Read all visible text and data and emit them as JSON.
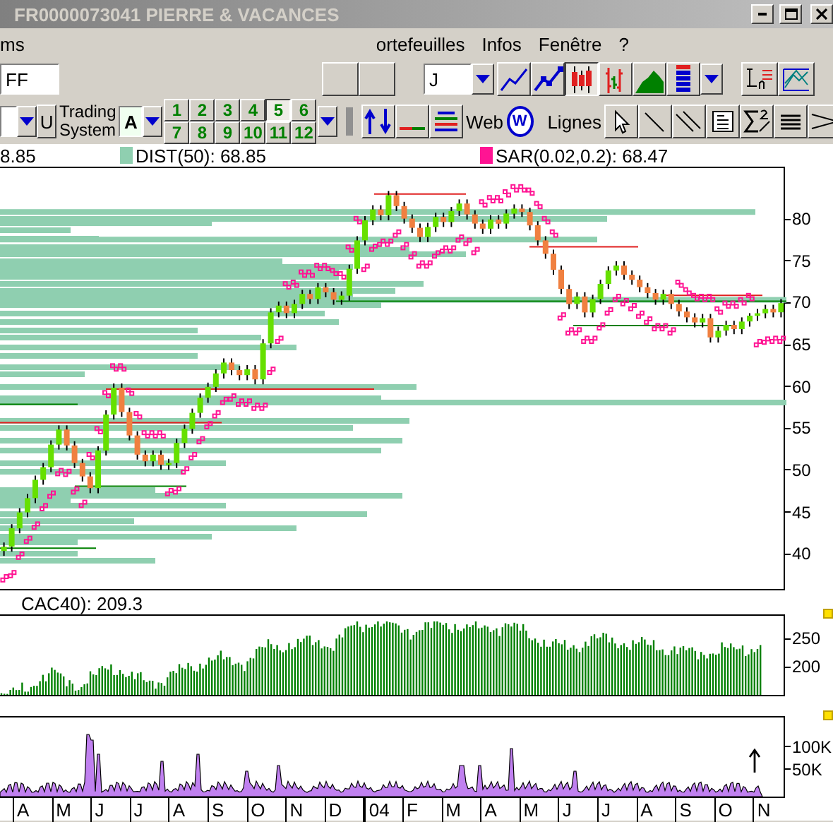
{
  "window": {
    "title": "FR0000073041  PIERRE & VACANCES",
    "active": false
  },
  "menu": [
    {
      "label": "ms"
    },
    {
      "label": "ortefeuilles"
    },
    {
      "label": "Infos"
    },
    {
      "label": "Fenêtre"
    },
    {
      "label": "?"
    }
  ],
  "toolbar_top": {
    "symbol_field": "FF",
    "period_field": "J",
    "chart_types": [
      {
        "kind": "line",
        "selected": false
      },
      {
        "kind": "line-points",
        "selected": false
      },
      {
        "kind": "candles",
        "selected": true
      },
      {
        "kind": "bars",
        "selected": false
      },
      {
        "kind": "area",
        "selected": false
      },
      {
        "kind": "colors",
        "selected": false
      }
    ]
  },
  "toolbar_bottom": {
    "u_button": "U",
    "trading_system_label": "Trading System",
    "system_field": "A",
    "layouts": [
      {
        "label": "1",
        "selected": false
      },
      {
        "label": "2",
        "selected": false
      },
      {
        "label": "3",
        "selected": false
      },
      {
        "label": "4",
        "selected": false
      },
      {
        "label": "5",
        "selected": true
      },
      {
        "label": "6",
        "selected": false
      },
      {
        "label": "7",
        "selected": false
      },
      {
        "label": "8",
        "selected": false
      },
      {
        "label": "9",
        "selected": false
      },
      {
        "label": "10",
        "selected": false
      },
      {
        "label": "11",
        "selected": false
      },
      {
        "label": "12",
        "selected": false
      }
    ],
    "web_label": "Web",
    "web_button": "W",
    "lines_label": "Lignes"
  },
  "price_panel": {
    "legends": [
      {
        "text": "8.85"
      },
      {
        "text": "DIST(50): 68.85",
        "color": "#8fcfb0"
      },
      {
        "text": "SAR(0.02,0.2): 68.47",
        "color": "#ff1493"
      }
    ],
    "chart_data": {
      "type": "candlestick",
      "ylim": [
        35.95,
        86.24
      ],
      "yticks": [
        80,
        75,
        70,
        65,
        60,
        55,
        50,
        45,
        40
      ],
      "ohlc": [
        [
          40.5,
          41.5,
          39.9,
          41.0
        ],
        [
          41.0,
          43.7,
          40.4,
          43.2
        ],
        [
          43.2,
          45.6,
          42.6,
          45.1
        ],
        [
          45.1,
          47.3,
          44.5,
          46.8
        ],
        [
          46.8,
          49.5,
          46.2,
          49.0
        ],
        [
          49.0,
          51.0,
          48.4,
          50.5
        ],
        [
          50.5,
          53.7,
          49.9,
          53.2
        ],
        [
          53.2,
          55.5,
          52.6,
          55.0
        ],
        [
          55.0,
          55.5,
          52.5,
          53.1
        ],
        [
          53.1,
          53.6,
          50.4,
          51.0
        ],
        [
          51.0,
          51.5,
          48.8,
          49.4
        ],
        [
          49.4,
          49.9,
          47.4,
          48.0
        ],
        [
          48.0,
          53.0,
          47.4,
          52.5
        ],
        [
          52.5,
          57.3,
          51.9,
          56.8
        ],
        [
          56.8,
          60.5,
          56.2,
          60.0
        ],
        [
          60.0,
          60.5,
          56.5,
          57.1
        ],
        [
          57.1,
          57.6,
          53.7,
          54.3
        ],
        [
          54.3,
          54.8,
          51.4,
          52.0
        ],
        [
          52.0,
          52.5,
          50.6,
          51.2
        ],
        [
          51.2,
          52.5,
          50.6,
          52.0
        ],
        [
          52.0,
          52.5,
          50.2,
          50.8
        ],
        [
          50.8,
          51.5,
          50.2,
          51.0
        ],
        [
          51.0,
          53.9,
          50.4,
          53.4
        ],
        [
          53.4,
          55.6,
          52.8,
          55.1
        ],
        [
          55.1,
          57.5,
          54.5,
          57.0
        ],
        [
          57.0,
          59.3,
          56.4,
          58.8
        ],
        [
          58.8,
          60.6,
          58.2,
          60.1
        ],
        [
          60.1,
          62.2,
          59.5,
          61.7
        ],
        [
          61.7,
          63.5,
          61.1,
          63.0
        ],
        [
          63.0,
          63.5,
          61.5,
          62.1
        ],
        [
          62.1,
          62.6,
          60.9,
          61.5
        ],
        [
          61.5,
          62.7,
          60.9,
          62.2
        ],
        [
          62.2,
          62.7,
          60.4,
          61.0
        ],
        [
          61.0,
          65.8,
          60.4,
          65.3
        ],
        [
          65.3,
          69.5,
          64.7,
          69.0
        ],
        [
          69.0,
          70.3,
          68.4,
          69.8
        ],
        [
          69.8,
          70.3,
          68.3,
          68.9
        ],
        [
          68.9,
          70.5,
          68.3,
          70.0
        ],
        [
          70.0,
          71.7,
          69.4,
          71.2
        ],
        [
          71.2,
          71.7,
          70.0,
          70.6
        ],
        [
          70.6,
          72.5,
          70.0,
          72.0
        ],
        [
          72.0,
          72.5,
          70.8,
          71.4
        ],
        [
          71.4,
          71.9,
          69.9,
          70.5
        ],
        [
          70.5,
          71.5,
          69.9,
          71.0
        ],
        [
          71.0,
          74.7,
          70.4,
          74.2
        ],
        [
          74.2,
          78.1,
          73.6,
          77.6
        ],
        [
          77.6,
          80.5,
          77.0,
          80.0
        ],
        [
          80.0,
          81.8,
          79.4,
          81.3
        ],
        [
          81.3,
          81.8,
          80.0,
          80.6
        ],
        [
          80.6,
          83.5,
          80.0,
          83.0
        ],
        [
          83.0,
          83.5,
          81.1,
          81.7
        ],
        [
          81.7,
          82.2,
          79.6,
          80.2
        ],
        [
          80.2,
          80.7,
          78.5,
          79.1
        ],
        [
          79.1,
          79.6,
          77.4,
          78.0
        ],
        [
          78.0,
          79.7,
          77.4,
          79.2
        ],
        [
          79.2,
          80.9,
          78.6,
          80.4
        ],
        [
          80.4,
          80.9,
          79.2,
          79.8
        ],
        [
          79.8,
          81.6,
          79.2,
          81.1
        ],
        [
          81.1,
          82.5,
          80.5,
          82.0
        ],
        [
          82.0,
          82.5,
          80.1,
          80.7
        ],
        [
          80.7,
          81.2,
          79.0,
          79.6
        ],
        [
          79.6,
          80.1,
          78.4,
          79.0
        ],
        [
          79.0,
          80.6,
          78.4,
          80.1
        ],
        [
          80.1,
          80.6,
          79.0,
          79.6
        ],
        [
          79.6,
          81.3,
          79.0,
          80.8
        ],
        [
          80.8,
          81.9,
          80.2,
          81.4
        ],
        [
          81.4,
          81.9,
          80.4,
          81.0
        ],
        [
          81.0,
          81.5,
          78.8,
          79.4
        ],
        [
          79.4,
          79.9,
          77.0,
          77.6
        ],
        [
          77.6,
          78.1,
          75.4,
          76.0
        ],
        [
          76.0,
          76.5,
          73.5,
          74.1
        ],
        [
          74.1,
          74.6,
          71.2,
          71.8
        ],
        [
          71.8,
          72.3,
          69.4,
          70.0
        ],
        [
          70.0,
          71.4,
          69.4,
          70.9
        ],
        [
          70.9,
          71.4,
          68.4,
          69.0
        ],
        [
          69.0,
          71.1,
          68.4,
          70.6
        ],
        [
          70.6,
          72.9,
          70.0,
          72.4
        ],
        [
          72.4,
          74.5,
          71.8,
          74.0
        ],
        [
          74.0,
          75.1,
          73.4,
          74.6
        ],
        [
          74.6,
          75.1,
          72.9,
          73.5
        ],
        [
          73.5,
          74.0,
          72.3,
          72.9
        ],
        [
          72.9,
          73.4,
          71.4,
          72.0
        ],
        [
          72.0,
          72.5,
          70.7,
          71.3
        ],
        [
          71.3,
          71.8,
          69.9,
          70.5
        ],
        [
          70.5,
          71.7,
          69.9,
          71.2
        ],
        [
          71.2,
          71.7,
          69.4,
          70.0
        ],
        [
          70.0,
          70.5,
          68.5,
          69.1
        ],
        [
          69.1,
          69.6,
          67.8,
          68.4
        ],
        [
          68.4,
          68.9,
          67.2,
          67.8
        ],
        [
          67.8,
          68.8,
          67.2,
          68.3
        ],
        [
          68.3,
          68.8,
          65.4,
          66.0
        ],
        [
          66.0,
          67.3,
          65.4,
          66.8
        ],
        [
          66.8,
          68.0,
          66.2,
          67.5
        ],
        [
          67.5,
          68.0,
          66.4,
          67.0
        ],
        [
          67.0,
          68.4,
          66.4,
          67.9
        ],
        [
          67.9,
          68.9,
          67.3,
          68.6
        ],
        [
          68.6,
          69.4,
          68.0,
          68.9
        ],
        [
          68.9,
          69.9,
          68.3,
          69.4
        ],
        [
          69.4,
          69.9,
          68.4,
          69.0
        ],
        [
          69.0,
          70.6,
          68.4,
          70.1
        ]
      ]
    }
  },
  "index_panel": {
    "legends": [
      "CAC40): 209.3"
    ],
    "y_ticks": [
      "250",
      "200"
    ]
  },
  "volume_panel": {
    "y_ticks": [
      "100K",
      "50K"
    ]
  },
  "x_axis": [
    {
      "label": "A",
      "kind": "month"
    },
    {
      "label": "M",
      "kind": "month"
    },
    {
      "label": "J",
      "kind": "month"
    },
    {
      "label": "J",
      "kind": "month"
    },
    {
      "label": "A",
      "kind": "month"
    },
    {
      "label": "S",
      "kind": "month"
    },
    {
      "label": "O",
      "kind": "month"
    },
    {
      "label": "N",
      "kind": "month"
    },
    {
      "label": "D",
      "kind": "month"
    },
    {
      "label": "04",
      "kind": "year"
    },
    {
      "label": "F",
      "kind": "month"
    },
    {
      "label": "M",
      "kind": "month"
    },
    {
      "label": "A",
      "kind": "month"
    },
    {
      "label": "M",
      "kind": "month"
    },
    {
      "label": "J",
      "kind": "month"
    },
    {
      "label": "J",
      "kind": "month"
    },
    {
      "label": "A",
      "kind": "month"
    },
    {
      "label": "S",
      "kind": "month"
    },
    {
      "label": "O",
      "kind": "month"
    },
    {
      "label": "N",
      "kind": "month"
    }
  ]
}
